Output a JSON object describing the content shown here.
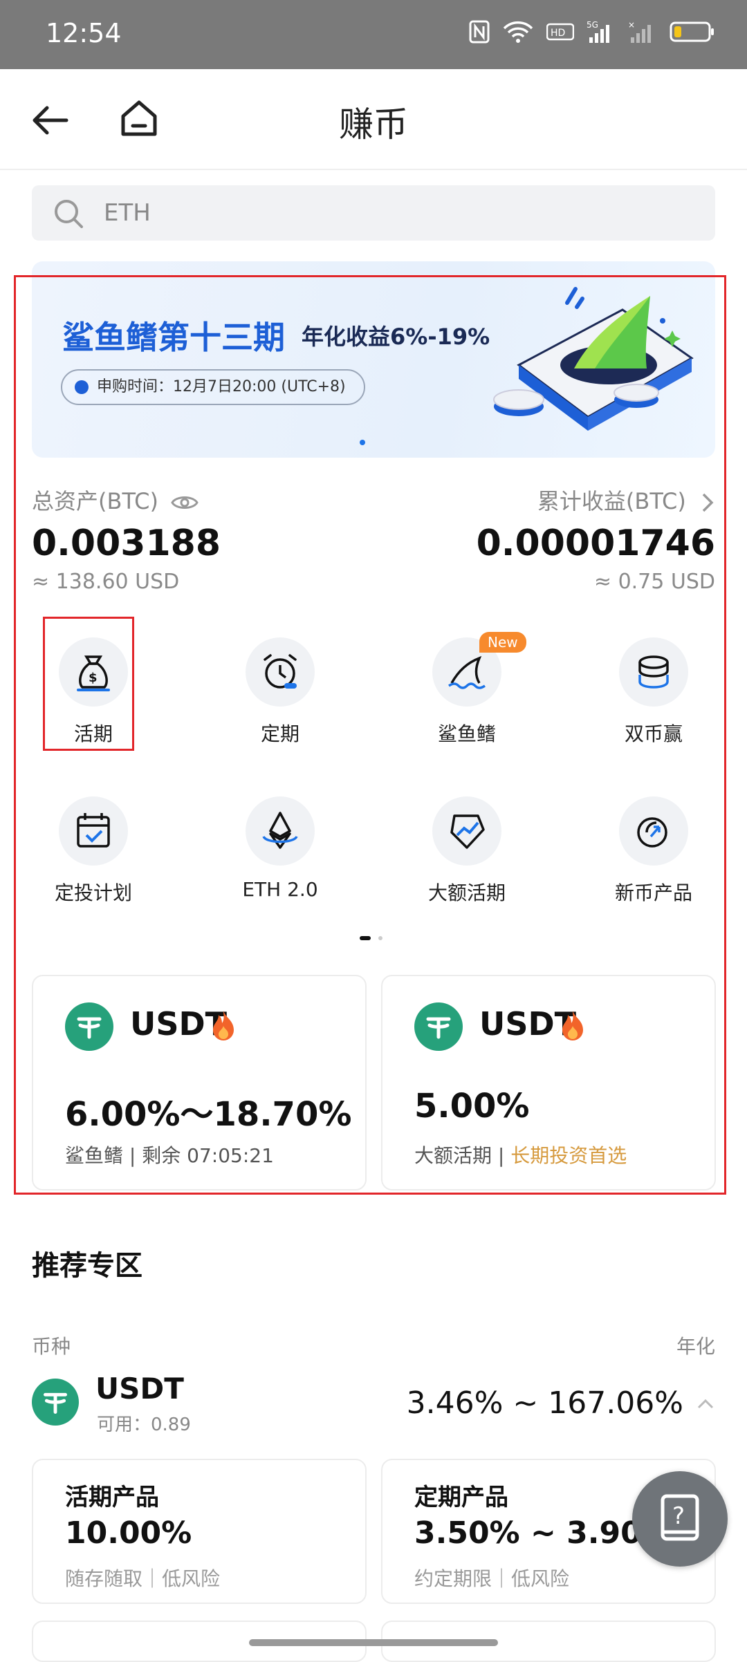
{
  "status": {
    "time": "12:54"
  },
  "nav": {
    "title": "赚币"
  },
  "search": {
    "placeholder": "ETH"
  },
  "banner": {
    "title": "鲨鱼鳍第十三期",
    "subtitle": "年化收益6%-19%",
    "time": "申购时间：12月7日20:00 (UTC+8)"
  },
  "assets": {
    "total_label": "总资产(BTC)",
    "total_value": "0.003188",
    "total_usd": "≈ 138.60 USD",
    "earn_label": "累计收益(BTC)",
    "earn_value": "0.00001746",
    "earn_usd": "≈ 0.75 USD"
  },
  "menu": [
    {
      "label": "活期",
      "icon": "money-bag-icon"
    },
    {
      "label": "定期",
      "icon": "alarm-clock-icon"
    },
    {
      "label": "鲨鱼鳍",
      "icon": "shark-fin-icon",
      "tag": "New"
    },
    {
      "label": "双币赢",
      "icon": "coin-stack-icon"
    },
    {
      "label": "定投计划",
      "icon": "calendar-check-icon"
    },
    {
      "label": "ETH 2.0",
      "icon": "ethereum-icon"
    },
    {
      "label": "大额活期",
      "icon": "chart-tag-icon"
    },
    {
      "label": "新币产品",
      "icon": "new-coin-icon"
    }
  ],
  "cards": [
    {
      "coin": "USDT",
      "rate": "6.00%～18.70%",
      "desc": "鲨鱼鳍 | 剩余 07:05:21",
      "highlight": ""
    },
    {
      "coin": "USDT",
      "rate": "5.00%",
      "desc": "大额活期 | ",
      "highlight": "长期投资首选"
    }
  ],
  "recommend": {
    "title": "推荐专区",
    "col_coin": "币种",
    "col_rate": "年化",
    "coin": "USDT",
    "available": "可用：0.89",
    "rate": "3.46% ~ 167.06%",
    "products": [
      {
        "title": "活期产品",
        "rate": "10.00%",
        "desc": "随存随取｜低风险"
      },
      {
        "title": "定期产品",
        "rate": "3.50% ~ 3.90%",
        "desc": "约定期限｜低风险"
      }
    ]
  },
  "colors": {
    "accent": "#1d5fd6",
    "tether": "#26a17b",
    "highlight_red": "#e2262a",
    "gold": "#d69a3e"
  }
}
